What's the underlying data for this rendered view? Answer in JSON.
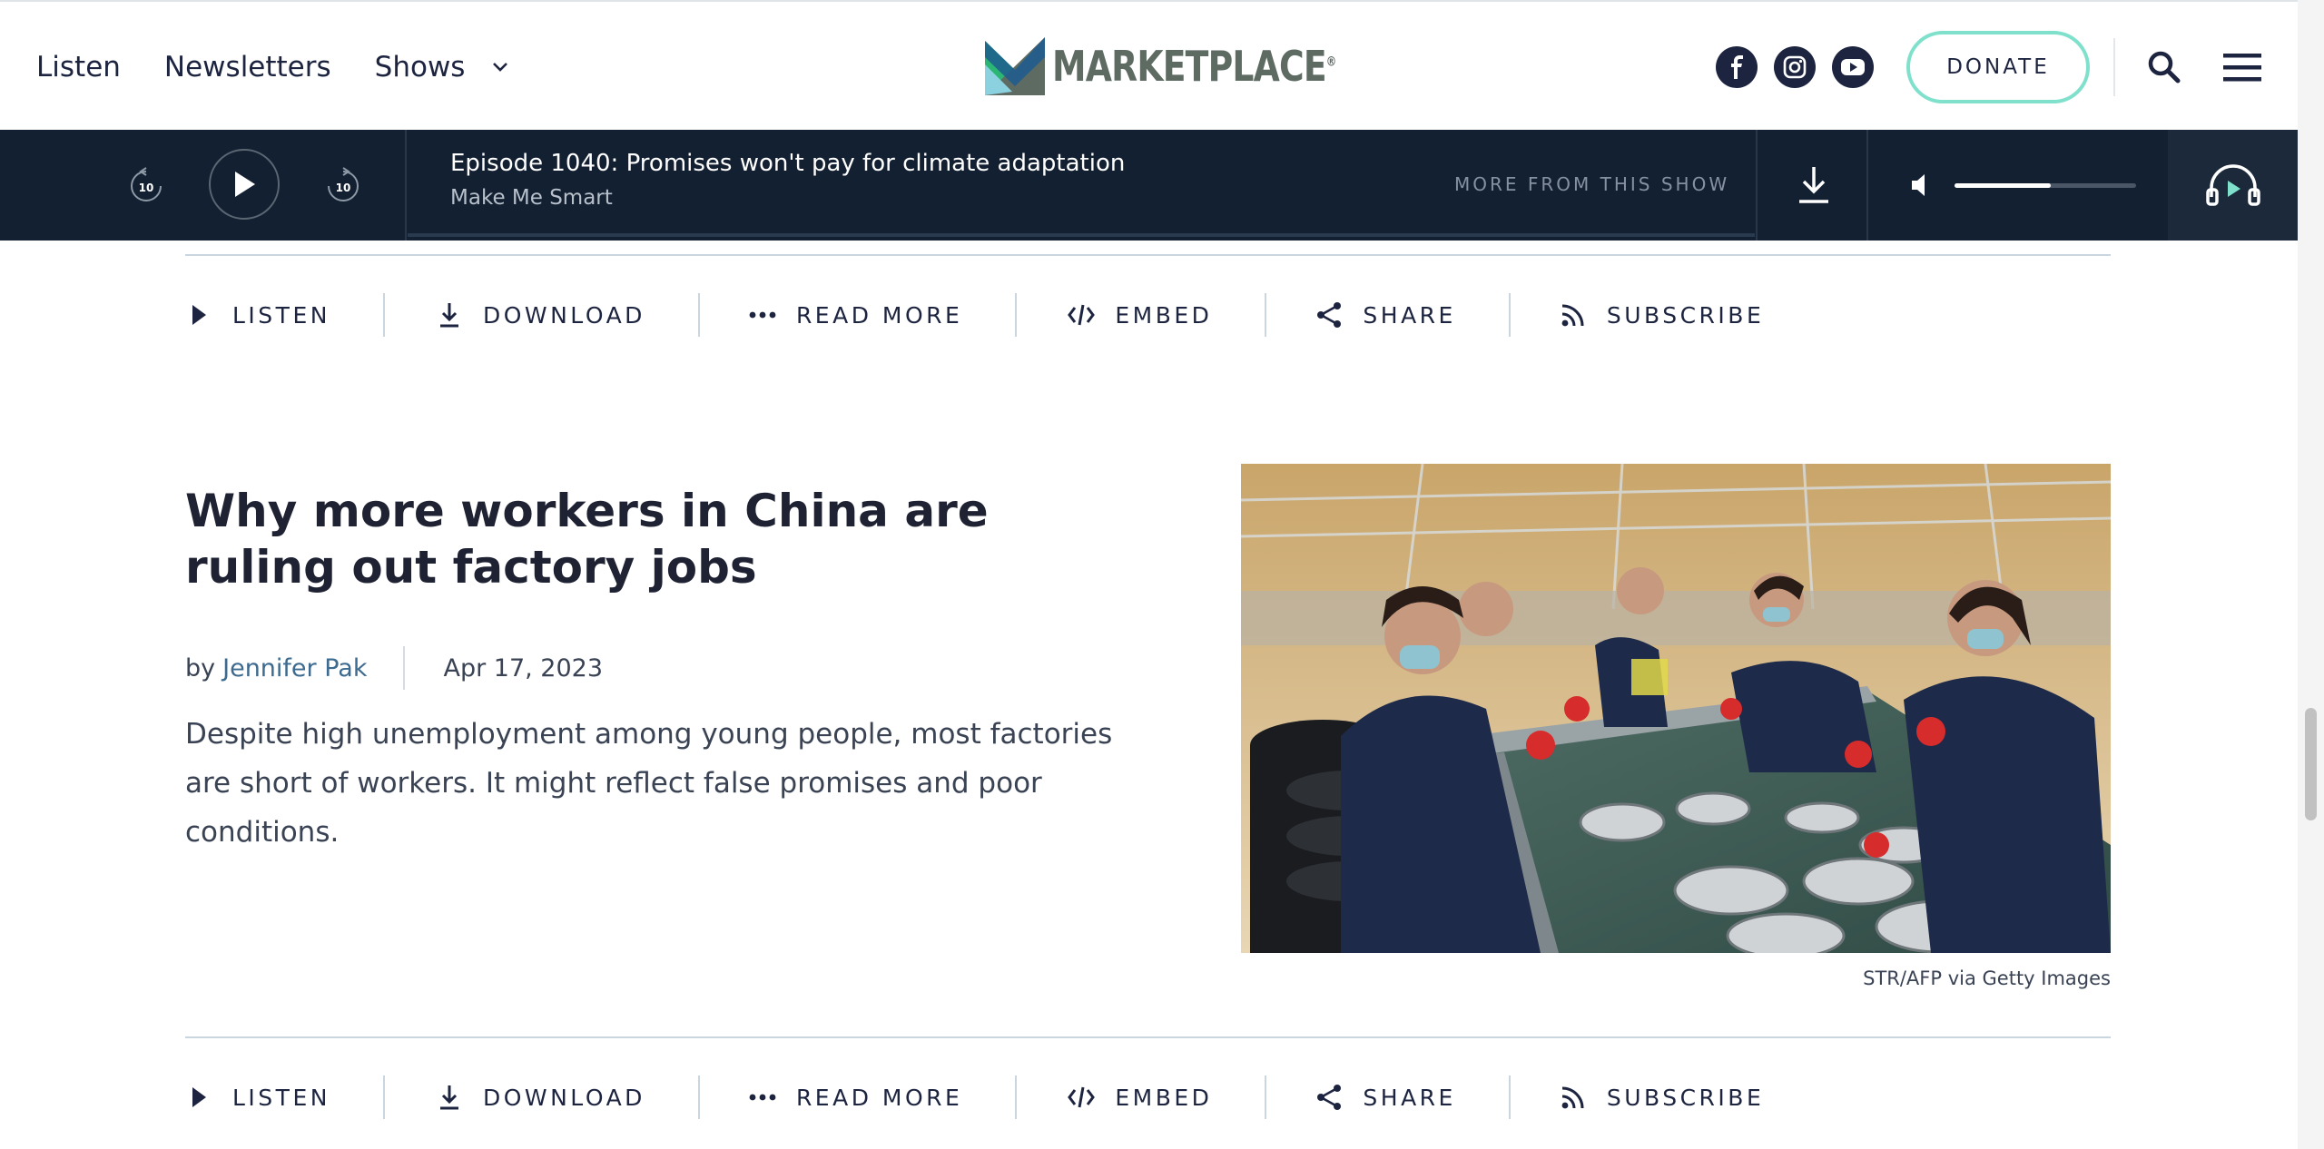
{
  "nav": {
    "links": [
      "Listen",
      "Newsletters",
      "Shows"
    ],
    "logo_text": "MARKETPLACE",
    "logo_mark": "®",
    "donate_label": "DONATE",
    "social": [
      "facebook-icon",
      "instagram-icon",
      "youtube-icon"
    ]
  },
  "player": {
    "skip_back_label": "10",
    "skip_forward_label": "10",
    "episode_title": "Episode 1040: Promises won't pay for climate adaptation",
    "show_name": "Make Me Smart",
    "more_from_label": "MORE FROM THIS SHOW",
    "volume": 0.53
  },
  "actions": {
    "listen": "LISTEN",
    "download": "DOWNLOAD",
    "read_more": "READ MORE",
    "embed": "EMBED",
    "share": "SHARE",
    "subscribe": "SUBSCRIBE"
  },
  "story": {
    "title": "Why more workers in China are ruling out factory jobs",
    "by_prefix": "by",
    "author": "Jennifer Pak",
    "date": "Apr 17, 2023",
    "summary": "Despite high unemployment among young people, most factories are short of workers. It might reflect false promises and poor conditions.",
    "image_credit": "STR/AFP via Getty Images"
  },
  "colors": {
    "navy": "#1d2440",
    "player_bg": "#132031",
    "donate_border": "#7fe0cb",
    "author_link": "#3d6a8f",
    "logo_green": "#2bb673",
    "logo_gray": "#5d6b63"
  }
}
